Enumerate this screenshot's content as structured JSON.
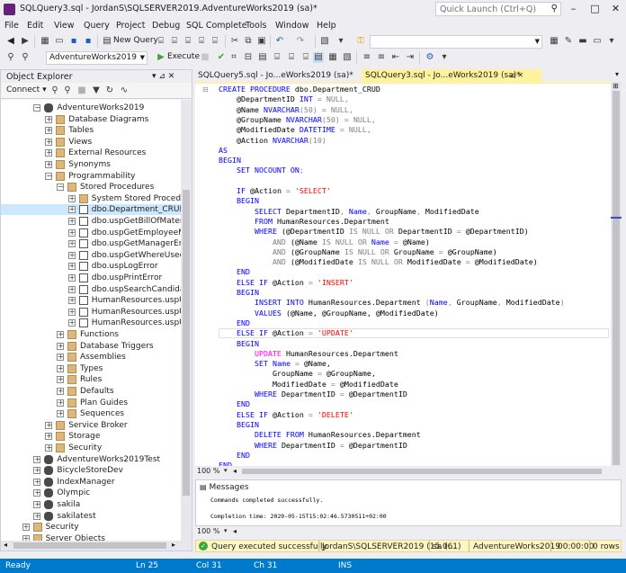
{
  "window": {
    "title": "SQLQuery3.sql - JordanS\\SQLSERVER2019.AdventureWorks2019 (sa)*",
    "quick_launch_placeholder": "Quick Launch (Ctrl+Q)",
    "minimize": "–",
    "maximize": "□",
    "close": "✕"
  },
  "menu": [
    "File",
    "Edit",
    "View",
    "Query",
    "Project",
    "Debug",
    "SQL Complete",
    "Tools",
    "Window",
    "Help"
  ],
  "toolbar1": {
    "new_query_label": "New Query"
  },
  "toolbar2": {
    "database": "AdventureWorks2019",
    "execute_label": "Execute"
  },
  "object_explorer": {
    "title": "Object Explorer",
    "pin": "▾ ⊿ ✕",
    "connect_label": "Connect ▾",
    "tree": [
      {
        "label": "AdventureWorks2019",
        "indent": 3,
        "exp": "−",
        "icon": "db"
      },
      {
        "label": "Database Diagrams",
        "indent": 4,
        "exp": "+",
        "icon": "folder"
      },
      {
        "label": "Tables",
        "indent": 4,
        "exp": "+",
        "icon": "folder"
      },
      {
        "label": "Views",
        "indent": 4,
        "exp": "+",
        "icon": "folder"
      },
      {
        "label": "External Resources",
        "indent": 4,
        "exp": "+",
        "icon": "folder"
      },
      {
        "label": "Synonyms",
        "indent": 4,
        "exp": "+",
        "icon": "folder"
      },
      {
        "label": "Programmability",
        "indent": 4,
        "exp": "−",
        "icon": "folder"
      },
      {
        "label": "Stored Procedures",
        "indent": 5,
        "exp": "−",
        "icon": "folder"
      },
      {
        "label": "System Stored Procedures",
        "indent": 6,
        "exp": "+",
        "icon": "folder"
      },
      {
        "label": "dbo.Department_CRUD",
        "indent": 6,
        "exp": "+",
        "icon": "sp",
        "selected": true
      },
      {
        "label": "dbo.uspGetBillOfMaterials",
        "indent": 6,
        "exp": "+",
        "icon": "sp"
      },
      {
        "label": "dbo.uspGetEmployeeMana",
        "indent": 6,
        "exp": "+",
        "icon": "sp"
      },
      {
        "label": "dbo.uspGetManagerEmplo",
        "indent": 6,
        "exp": "+",
        "icon": "sp"
      },
      {
        "label": "dbo.uspGetWhereUsedPro",
        "indent": 6,
        "exp": "+",
        "icon": "sp"
      },
      {
        "label": "dbo.uspLogError",
        "indent": 6,
        "exp": "+",
        "icon": "sp"
      },
      {
        "label": "dbo.uspPrintError",
        "indent": 6,
        "exp": "+",
        "icon": "sp"
      },
      {
        "label": "dbo.uspSearchCandidateR",
        "indent": 6,
        "exp": "+",
        "icon": "sp"
      },
      {
        "label": "HumanResources.uspUpd",
        "indent": 6,
        "exp": "+",
        "icon": "sp"
      },
      {
        "label": "HumanResources.uspUpd",
        "indent": 6,
        "exp": "+",
        "icon": "sp"
      },
      {
        "label": "HumanResources.uspUpd",
        "indent": 6,
        "exp": "+",
        "icon": "sp"
      },
      {
        "label": "Functions",
        "indent": 5,
        "exp": "+",
        "icon": "folder"
      },
      {
        "label": "Database Triggers",
        "indent": 5,
        "exp": "+",
        "icon": "folder"
      },
      {
        "label": "Assemblies",
        "indent": 5,
        "exp": "+",
        "icon": "folder"
      },
      {
        "label": "Types",
        "indent": 5,
        "exp": "+",
        "icon": "folder"
      },
      {
        "label": "Rules",
        "indent": 5,
        "exp": "+",
        "icon": "folder"
      },
      {
        "label": "Defaults",
        "indent": 5,
        "exp": "+",
        "icon": "folder"
      },
      {
        "label": "Plan Guides",
        "indent": 5,
        "exp": "+",
        "icon": "folder"
      },
      {
        "label": "Sequences",
        "indent": 5,
        "exp": "+",
        "icon": "folder"
      },
      {
        "label": "Service Broker",
        "indent": 4,
        "exp": "+",
        "icon": "folder"
      },
      {
        "label": "Storage",
        "indent": 4,
        "exp": "+",
        "icon": "folder"
      },
      {
        "label": "Security",
        "indent": 4,
        "exp": "+",
        "icon": "folder"
      },
      {
        "label": "AdventureWorks2019Test",
        "indent": 3,
        "exp": "+",
        "icon": "db"
      },
      {
        "label": "BicycleStoreDev",
        "indent": 3,
        "exp": "+",
        "icon": "db"
      },
      {
        "label": "IndexManager",
        "indent": 3,
        "exp": "+",
        "icon": "db"
      },
      {
        "label": "Olympic",
        "indent": 3,
        "exp": "+",
        "icon": "db"
      },
      {
        "label": "sakila",
        "indent": 3,
        "exp": "+",
        "icon": "db"
      },
      {
        "label": "sakilatest",
        "indent": 3,
        "exp": "+",
        "icon": "db"
      },
      {
        "label": "Security",
        "indent": 2,
        "exp": "+",
        "icon": "folder"
      },
      {
        "label": "Server Objects",
        "indent": 2,
        "exp": "+",
        "icon": "folder"
      }
    ]
  },
  "tabs": [
    {
      "label": "SQLQuery5.sql - Jo...eWorks2019 (sa)*",
      "active": false,
      "close": ""
    },
    {
      "label": "SQLQuery3.sql - Jo...eWorks2019 (sa)*",
      "active": true,
      "close": "⊿ ✕"
    }
  ],
  "code_lines": [
    [
      {
        "t": "CREATE PROCEDURE ",
        "c": "kw"
      },
      {
        "t": "dbo.Department_CRUD",
        "c": "var"
      }
    ],
    [
      {
        "t": "    @DepartmentID ",
        "c": "var"
      },
      {
        "t": "INT",
        "c": "kw"
      },
      {
        "t": " = ",
        "c": "op"
      },
      {
        "t": "NULL",
        "c": "op"
      },
      {
        "t": ",",
        "c": "op"
      }
    ],
    [
      {
        "t": "    @Name ",
        "c": "var"
      },
      {
        "t": "NVARCHAR",
        "c": "kw"
      },
      {
        "t": "(50) = ",
        "c": "op"
      },
      {
        "t": "NULL",
        "c": "op"
      },
      {
        "t": ",",
        "c": "op"
      }
    ],
    [
      {
        "t": "    @GroupName ",
        "c": "var"
      },
      {
        "t": "NVARCHAR",
        "c": "kw"
      },
      {
        "t": "(50) = ",
        "c": "op"
      },
      {
        "t": "NULL",
        "c": "op"
      },
      {
        "t": ",",
        "c": "op"
      }
    ],
    [
      {
        "t": "    @ModifiedDate ",
        "c": "var"
      },
      {
        "t": "DATETIME",
        "c": "kw"
      },
      {
        "t": " = ",
        "c": "op"
      },
      {
        "t": "NULL",
        "c": "op"
      },
      {
        "t": ",",
        "c": "op"
      }
    ],
    [
      {
        "t": "    @Action ",
        "c": "var"
      },
      {
        "t": "NVARCHAR",
        "c": "kw"
      },
      {
        "t": "(10)",
        "c": "op"
      }
    ],
    [
      {
        "t": "AS",
        "c": "kw"
      }
    ],
    [
      {
        "t": "BEGIN",
        "c": "kw"
      }
    ],
    [
      {
        "t": "    SET NOCOUNT ON",
        "c": "kw"
      },
      {
        "t": ";",
        "c": "op"
      }
    ],
    [
      {
        "t": "",
        "c": "var"
      }
    ],
    [
      {
        "t": "    IF ",
        "c": "kw"
      },
      {
        "t": "@Action ",
        "c": "var"
      },
      {
        "t": "= ",
        "c": "op"
      },
      {
        "t": "'SELECT'",
        "c": "str"
      }
    ],
    [
      {
        "t": "    BEGIN",
        "c": "kw"
      }
    ],
    [
      {
        "t": "        SELECT ",
        "c": "kw"
      },
      {
        "t": "DepartmentID",
        "c": "var"
      },
      {
        "t": ", ",
        "c": "op"
      },
      {
        "t": "Name",
        "c": "kw"
      },
      {
        "t": ", ",
        "c": "op"
      },
      {
        "t": "GroupName",
        "c": "var"
      },
      {
        "t": ", ",
        "c": "op"
      },
      {
        "t": "ModifiedDate",
        "c": "var"
      }
    ],
    [
      {
        "t": "        FROM ",
        "c": "kw"
      },
      {
        "t": "HumanResources.Department",
        "c": "var"
      }
    ],
    [
      {
        "t": "        WHERE ",
        "c": "kw"
      },
      {
        "t": "(@DepartmentID ",
        "c": "var"
      },
      {
        "t": "IS NULL OR ",
        "c": "op"
      },
      {
        "t": "DepartmentID ",
        "c": "var"
      },
      {
        "t": "= ",
        "c": "op"
      },
      {
        "t": "@DepartmentID)",
        "c": "var"
      }
    ],
    [
      {
        "t": "            AND ",
        "c": "op"
      },
      {
        "t": "(@Name ",
        "c": "var"
      },
      {
        "t": "IS NULL OR ",
        "c": "op"
      },
      {
        "t": "Name ",
        "c": "kw"
      },
      {
        "t": "= ",
        "c": "op"
      },
      {
        "t": "@Name)",
        "c": "var"
      }
    ],
    [
      {
        "t": "            AND ",
        "c": "op"
      },
      {
        "t": "(@GroupName ",
        "c": "var"
      },
      {
        "t": "IS NULL OR ",
        "c": "op"
      },
      {
        "t": "GroupName ",
        "c": "var"
      },
      {
        "t": "= ",
        "c": "op"
      },
      {
        "t": "@GroupName)",
        "c": "var"
      }
    ],
    [
      {
        "t": "            AND ",
        "c": "op"
      },
      {
        "t": "(@ModifiedDate ",
        "c": "var"
      },
      {
        "t": "IS NULL OR ",
        "c": "op"
      },
      {
        "t": "ModifiedDate ",
        "c": "var"
      },
      {
        "t": "= ",
        "c": "op"
      },
      {
        "t": "@ModifiedDate)",
        "c": "var"
      }
    ],
    [
      {
        "t": "    END",
        "c": "kw"
      }
    ],
    [
      {
        "t": "    ELSE IF ",
        "c": "kw"
      },
      {
        "t": "@Action ",
        "c": "var"
      },
      {
        "t": "= ",
        "c": "op"
      },
      {
        "t": "'INSERT'",
        "c": "str"
      }
    ],
    [
      {
        "t": "    BEGIN",
        "c": "kw"
      }
    ],
    [
      {
        "t": "        INSERT INTO ",
        "c": "kw"
      },
      {
        "t": "HumanResources.Department ",
        "c": "var"
      },
      {
        "t": "(",
        "c": "op"
      },
      {
        "t": "Name",
        "c": "kw"
      },
      {
        "t": ", ",
        "c": "op"
      },
      {
        "t": "GroupName",
        "c": "var"
      },
      {
        "t": ", ",
        "c": "op"
      },
      {
        "t": "ModifiedDate",
        "c": "var"
      },
      {
        "t": ")",
        "c": "op"
      }
    ],
    [
      {
        "t": "        VALUES ",
        "c": "kw"
      },
      {
        "t": "(@Name, @GroupName, @ModifiedDate)",
        "c": "var"
      }
    ],
    [
      {
        "t": "    END",
        "c": "kw"
      }
    ],
    [
      {
        "t": "    ELSE IF ",
        "c": "kw"
      },
      {
        "t": "@Action ",
        "c": "var"
      },
      {
        "t": "= ",
        "c": "op"
      },
      {
        "t": "'UPDATE'",
        "c": "str"
      }
    ],
    [
      {
        "t": "    BEGIN",
        "c": "kw"
      }
    ],
    [
      {
        "t": "        UPDATE ",
        "c": "fn"
      },
      {
        "t": "HumanResources.Department",
        "c": "var"
      }
    ],
    [
      {
        "t": "        SET ",
        "c": "kw"
      },
      {
        "t": "Name ",
        "c": "kw"
      },
      {
        "t": "= ",
        "c": "op"
      },
      {
        "t": "@Name,",
        "c": "var"
      }
    ],
    [
      {
        "t": "            GroupName ",
        "c": "var"
      },
      {
        "t": "= ",
        "c": "op"
      },
      {
        "t": "@GroupName,",
        "c": "var"
      }
    ],
    [
      {
        "t": "            ModifiedDate ",
        "c": "var"
      },
      {
        "t": "= ",
        "c": "op"
      },
      {
        "t": "@ModifiedDate",
        "c": "var"
      }
    ],
    [
      {
        "t": "        WHERE ",
        "c": "kw"
      },
      {
        "t": "DepartmentID ",
        "c": "var"
      },
      {
        "t": "= ",
        "c": "op"
      },
      {
        "t": "@DepartmentID",
        "c": "var"
      }
    ],
    [
      {
        "t": "    END",
        "c": "kw"
      }
    ],
    [
      {
        "t": "    ELSE IF ",
        "c": "kw"
      },
      {
        "t": "@Action ",
        "c": "var"
      },
      {
        "t": "= ",
        "c": "op"
      },
      {
        "t": "'DELETE'",
        "c": "str"
      }
    ],
    [
      {
        "t": "    BEGIN",
        "c": "kw"
      }
    ],
    [
      {
        "t": "        DELETE FROM ",
        "c": "kw"
      },
      {
        "t": "HumanResources.Department",
        "c": "var"
      }
    ],
    [
      {
        "t": "        WHERE ",
        "c": "kw"
      },
      {
        "t": "DepartmentID ",
        "c": "var"
      },
      {
        "t": "= ",
        "c": "op"
      },
      {
        "t": "@DepartmentID",
        "c": "var"
      }
    ],
    [
      {
        "t": "    END",
        "c": "kw"
      }
    ],
    [
      {
        "t": "END",
        "c": "kw"
      }
    ]
  ],
  "zoom": "100 %",
  "results": {
    "tab_label": "Messages",
    "line1": "Commands completed successfully.",
    "line2": "Completion time: 2020-05-15T15:02:46.5730511+02:00"
  },
  "query_status": {
    "message": "Query executed successfully.",
    "server": "JordanS\\SQLSERVER2019 (15.0...",
    "user": "sa (61)",
    "database": "AdventureWorks2019",
    "elapsed": "00:00:00",
    "rows": "0 rows"
  },
  "statusbar": {
    "ready": "Ready",
    "ln": "Ln 25",
    "col": "Col 31",
    "ch": "Ch 31",
    "ins": "INS"
  },
  "colors": {
    "accent": "#007acc",
    "selected_item": "#cce8ff",
    "active_tab": "#fff29d",
    "status_ok": "#3ca53c"
  }
}
